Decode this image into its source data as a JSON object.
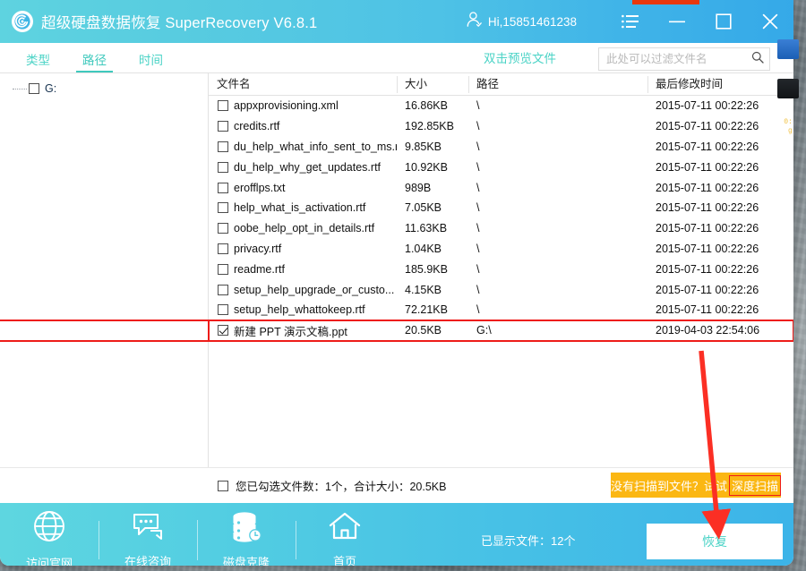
{
  "window": {
    "title": "超级硬盘数据恢复 SuperRecovery V6.8.1",
    "logo_icon": "disk-spiral-logo-icon",
    "account_icon": "user-icon",
    "account_label": "Hi,15851461238",
    "menu_icon": "list-menu-icon",
    "minimize_icon": "minimize-icon",
    "maximize_icon": "maximize-icon",
    "close_icon": "close-icon"
  },
  "tabs": [
    {
      "label": "类型",
      "active": false
    },
    {
      "label": "路径",
      "active": true
    },
    {
      "label": "时间",
      "active": false
    }
  ],
  "preview_hint": "双击预览文件",
  "search": {
    "placeholder": "此处可以过滤文件名",
    "value": "",
    "icon": "search-icon"
  },
  "tree": {
    "items": [
      {
        "label": "G:",
        "checked": false
      }
    ]
  },
  "table": {
    "headers": {
      "name": "文件名",
      "size": "大小",
      "path": "路径",
      "time": "最后修改时间"
    },
    "rows": [
      {
        "checked": false,
        "name": "appxprovisioning.xml",
        "size": "16.86KB",
        "path": "\\",
        "time": "2015-07-11 00:22:26",
        "selected": false
      },
      {
        "checked": false,
        "name": "credits.rtf",
        "size": "192.85KB",
        "path": "\\",
        "time": "2015-07-11 00:22:26",
        "selected": false
      },
      {
        "checked": false,
        "name": "du_help_what_info_sent_to_ms.rtf",
        "size": "9.85KB",
        "path": "\\",
        "time": "2015-07-11 00:22:26",
        "selected": false
      },
      {
        "checked": false,
        "name": "du_help_why_get_updates.rtf",
        "size": "10.92KB",
        "path": "\\",
        "time": "2015-07-11 00:22:26",
        "selected": false
      },
      {
        "checked": false,
        "name": "erofflps.txt",
        "size": "989B",
        "path": "\\",
        "time": "2015-07-11 00:22:26",
        "selected": false
      },
      {
        "checked": false,
        "name": "help_what_is_activation.rtf",
        "size": "7.05KB",
        "path": "\\",
        "time": "2015-07-11 00:22:26",
        "selected": false
      },
      {
        "checked": false,
        "name": "oobe_help_opt_in_details.rtf",
        "size": "11.63KB",
        "path": "\\",
        "time": "2015-07-11 00:22:26",
        "selected": false
      },
      {
        "checked": false,
        "name": "privacy.rtf",
        "size": "1.04KB",
        "path": "\\",
        "time": "2015-07-11 00:22:26",
        "selected": false
      },
      {
        "checked": false,
        "name": "readme.rtf",
        "size": "185.9KB",
        "path": "\\",
        "time": "2015-07-11 00:22:26",
        "selected": false
      },
      {
        "checked": false,
        "name": "setup_help_upgrade_or_custo...",
        "size": "4.15KB",
        "path": "\\",
        "time": "2015-07-11 00:22:26",
        "selected": false
      },
      {
        "checked": false,
        "name": "setup_help_whattokeep.rtf",
        "size": "72.21KB",
        "path": "\\",
        "time": "2015-07-11 00:22:26",
        "selected": false
      },
      {
        "checked": true,
        "name": "新建 PPT 演示文稿.ppt",
        "size": "20.5KB",
        "path": "G:\\",
        "time": "2019-04-03 22:54:06",
        "selected": true
      }
    ]
  },
  "status": {
    "selection_summary": "您已勾选文件数：1个，合计大小：20.5KB",
    "select_all_checked": false,
    "deep_scan_prefix": "没有扫描到文件？试试",
    "deep_scan_highlight": "深度扫描"
  },
  "bottom_nav": [
    {
      "label": "访问官网",
      "icon": "globe-icon"
    },
    {
      "label": "在线咨询",
      "icon": "chat-bubble-icon"
    },
    {
      "label": "磁盘克隆",
      "icon": "disk-clone-icon"
    },
    {
      "label": "首页",
      "icon": "home-icon"
    }
  ],
  "bottom": {
    "shown_count": "已显示文件：12个",
    "recover_label": "恢复"
  },
  "annotation": {
    "arrow_color": "#fb2f24",
    "highlight_color": "#ee1c19"
  }
}
